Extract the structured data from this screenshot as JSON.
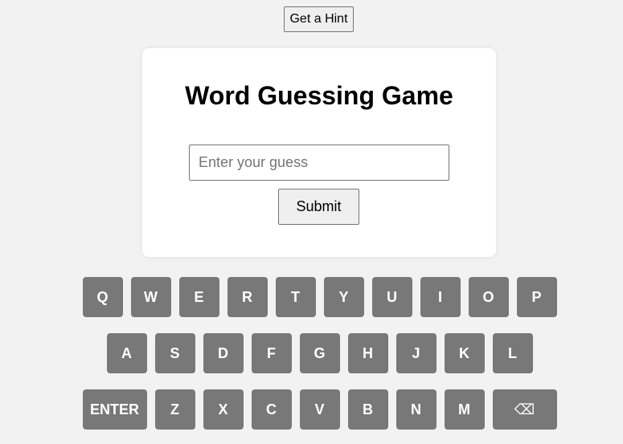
{
  "hint_button": {
    "label": "Get a Hint"
  },
  "card": {
    "title": "Word Guessing Game",
    "input": {
      "value": "",
      "placeholder": "Enter your guess"
    },
    "submit_label": "Submit"
  },
  "keyboard": {
    "rows": [
      [
        "Q",
        "W",
        "E",
        "R",
        "T",
        "Y",
        "U",
        "I",
        "O",
        "P"
      ],
      [
        "A",
        "S",
        "D",
        "F",
        "G",
        "H",
        "J",
        "K",
        "L"
      ],
      [
        "ENTER",
        "Z",
        "X",
        "C",
        "V",
        "B",
        "N",
        "M",
        "⌫"
      ]
    ]
  },
  "colors": {
    "background": "#f2f2f2",
    "card": "#ffffff",
    "key": "#787878",
    "key_text": "#ffffff"
  }
}
